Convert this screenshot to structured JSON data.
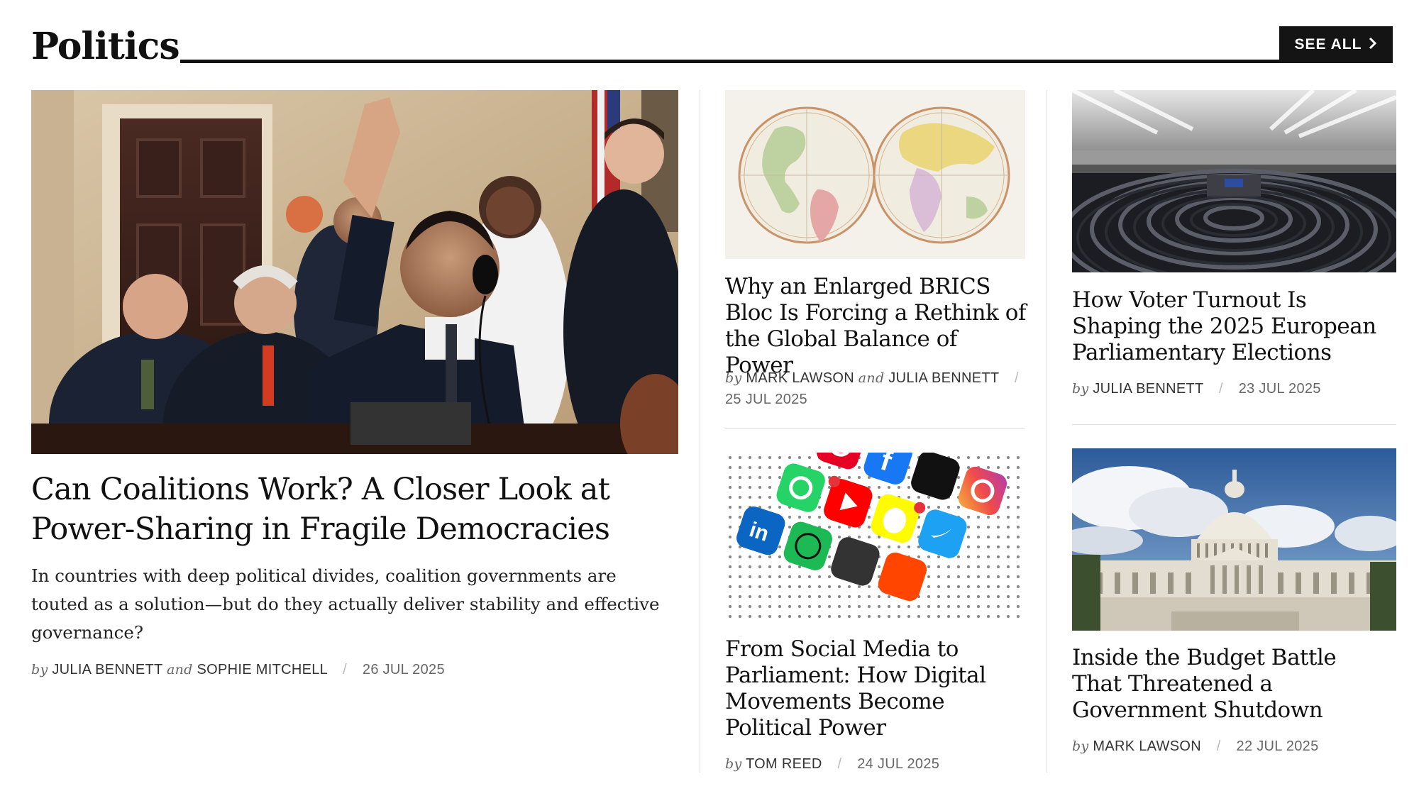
{
  "section": {
    "title": "Politics",
    "see_all_label": "SEE ALL",
    "see_all_icon": "chevron-right-icon"
  },
  "lead": {
    "title": "Can Coalitions Work? A Closer Look at Power-Sharing in Fragile Democracies",
    "dek": "In countries with deep political divides, coalition governments are touted as a solution—but do they actually deliver stability and effective governance?",
    "by": "by",
    "author1": "JULIA BENNETT",
    "and": "and",
    "author2": "SOPHIE MITCHELL",
    "date": "26 JUL 2025"
  },
  "col2": [
    {
      "title": "Why an Enlarged BRICS Bloc Is Forcing a Rethink of the Global Balance of Power",
      "by": "by",
      "author1": "MARK LAWSON",
      "and": "and",
      "author2": "JULIA BENNETT",
      "date": "25 JUL 2025"
    },
    {
      "title": "From Social Media to Parliament: How Digital Movements Become Political Power",
      "by": "by",
      "author1": "TOM REED",
      "date": "24 JUL 2025"
    }
  ],
  "col3": [
    {
      "title": "How Voter Turnout Is Shaping the 2025 European Parliamentary Elections",
      "by": "by",
      "author1": "JULIA BENNETT",
      "date": "23 JUL 2025"
    },
    {
      "title": "Inside the Budget Battle That Threatened a Government Shutdown",
      "by": "by",
      "author1": "MARK LAWSON",
      "date": "22 JUL 2025"
    }
  ],
  "colors": {
    "text": "#111111",
    "meta": "#666666",
    "button_bg": "#141414",
    "button_text": "#ffffff",
    "divider": "#e2e2e2"
  }
}
